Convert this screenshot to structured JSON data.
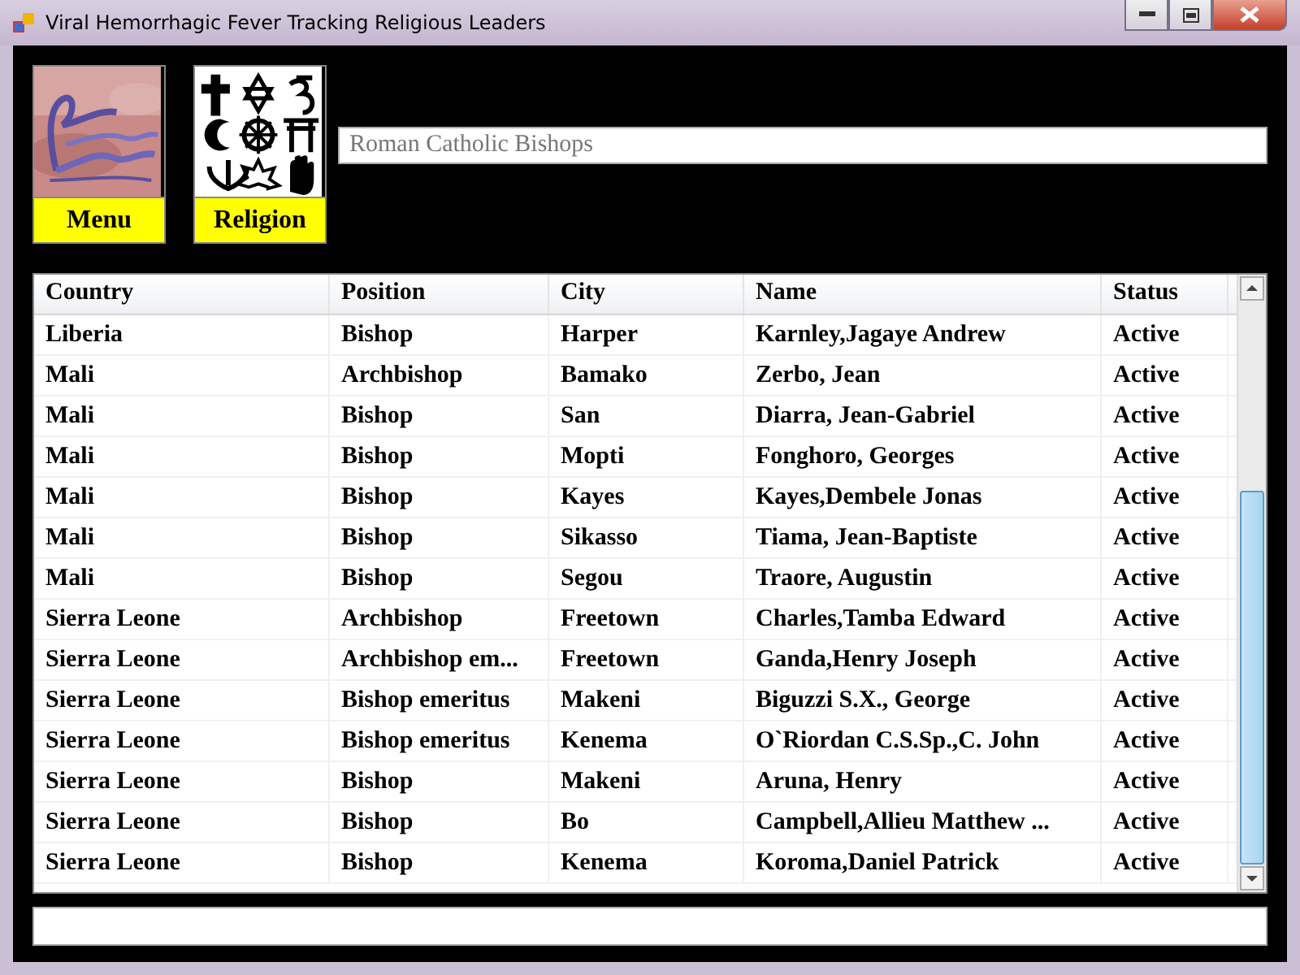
{
  "window": {
    "title": "Viral Hemorrhagic Fever Tracking Religious Leaders"
  },
  "buttons": [
    {
      "kind": "picture",
      "label": "Menu"
    },
    {
      "kind": "symbols",
      "label": "Religion"
    }
  ],
  "search": {
    "placeholder": "Roman Catholic Bishops"
  },
  "table": {
    "columns": [
      "Country",
      "Position",
      "City",
      "Name",
      "Status"
    ],
    "rows": [
      [
        "Liberia",
        "Bishop",
        "Harper",
        "Karnley,Jagaye Andrew",
        "Active"
      ],
      [
        "Mali",
        "Archbishop",
        "Bamako",
        "Zerbo, Jean",
        "Active"
      ],
      [
        "Mali",
        "Bishop",
        "San",
        "Diarra, Jean-Gabriel",
        "Active"
      ],
      [
        "Mali",
        "Bishop",
        "Mopti",
        "Fonghoro, Georges",
        "Active"
      ],
      [
        "Mali",
        "Bishop",
        "Kayes",
        "Kayes,Dembele Jonas",
        "Active"
      ],
      [
        "Mali",
        "Bishop",
        "Sikasso",
        "Tiama, Jean-Baptiste",
        "Active"
      ],
      [
        "Mali",
        "Bishop",
        "Segou",
        "Traore, Augustin",
        "Active"
      ],
      [
        "Sierra Leone",
        "Archbishop",
        "Freetown",
        "Charles,Tamba Edward",
        "Active"
      ],
      [
        "Sierra Leone",
        "Archbishop em...",
        "Freetown",
        "Ganda,Henry Joseph",
        "Active"
      ],
      [
        "Sierra Leone",
        "Bishop emeritus",
        "Makeni",
        "Biguzzi S.X., George",
        "Active"
      ],
      [
        "Sierra Leone",
        "Bishop emeritus",
        "Kenema",
        "O`Riordan C.S.Sp.,C. John",
        "Active"
      ],
      [
        "Sierra Leone",
        "Bishop",
        "Makeni",
        "Aruna, Henry",
        "Active"
      ],
      [
        "Sierra Leone",
        "Bishop",
        "Bo",
        "Campbell,Allieu Matthew ...",
        "Active"
      ],
      [
        "Sierra Leone",
        "Bishop",
        "Kenema",
        "Koroma,Daniel Patrick",
        "Active"
      ]
    ]
  }
}
